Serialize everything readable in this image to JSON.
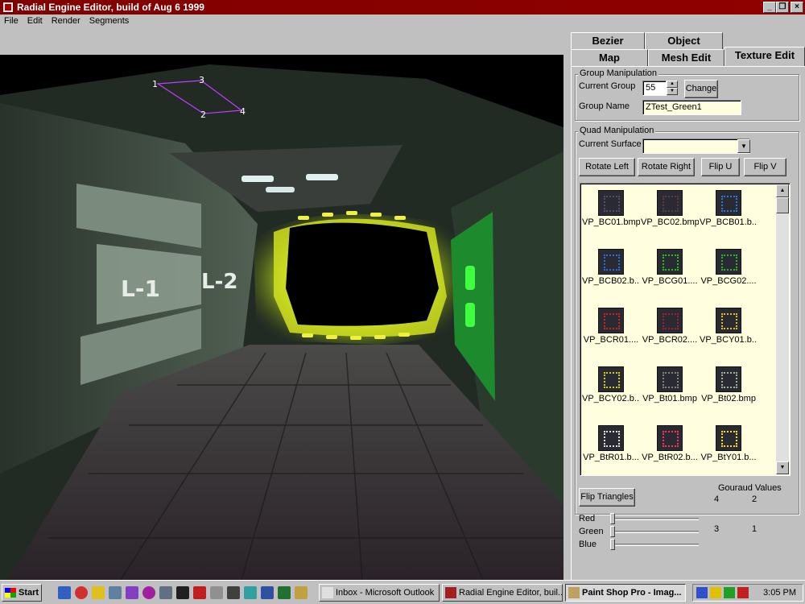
{
  "window": {
    "title": "Radial Engine Editor, build of Aug  6 1999",
    "minimize": "_",
    "maximize": "❐",
    "close": "×"
  },
  "menu": [
    "File",
    "Edit",
    "Render",
    "Segments"
  ],
  "viewport": {
    "markers": [
      "1",
      "3",
      "2",
      "4"
    ],
    "wall_signs": [
      "L-1",
      "L-2"
    ]
  },
  "tabs": {
    "row1": [
      "Bezier",
      "Object"
    ],
    "row2": [
      "Map",
      "Mesh Edit",
      "Texture Edit"
    ],
    "active": "Texture Edit"
  },
  "group_manipulation": {
    "legend": "Group Manipulation",
    "current_group_label": "Current Group",
    "current_group_value": "55",
    "change_button": "Change",
    "group_name_label": "Group Name",
    "group_name_value": "ZTest_Green1"
  },
  "quad_manipulation": {
    "legend": "Quad Manipulation",
    "current_surface_label": "Current Surface",
    "current_surface_value": "",
    "buttons": [
      "Rotate Left",
      "Rotate Right",
      "Flip U",
      "Flip V"
    ]
  },
  "textures": [
    {
      "name": "VP_BC01.bmp",
      "color": "#5a4a6a"
    },
    {
      "name": "VP_BC02.bmp",
      "color": "#5a3a4a"
    },
    {
      "name": "VP_BCB01.b...",
      "color": "#2a7ad8"
    },
    {
      "name": "VP_BCB02.b...",
      "color": "#2a6ae0"
    },
    {
      "name": "VP_BCG01....",
      "color": "#20c020"
    },
    {
      "name": "VP_BCG02....",
      "color": "#30b030"
    },
    {
      "name": "VP_BCR01....",
      "color": "#d02020"
    },
    {
      "name": "VP_BCR02....",
      "color": "#a02030"
    },
    {
      "name": "VP_BCY01.b...",
      "color": "#e0c020"
    },
    {
      "name": "VP_BCY02.b...",
      "color": "#d8c818"
    },
    {
      "name": "VP_Bt01.bmp",
      "color": "#808080"
    },
    {
      "name": "VP_Bt02.bmp",
      "color": "#a0b0a0"
    },
    {
      "name": "VP_BtR01.b...",
      "color": "#e0e0e0"
    },
    {
      "name": "VP_BtR02.b...",
      "color": "#ff3050"
    },
    {
      "name": "VP_BtY01.b...",
      "color": "#ffe020"
    }
  ],
  "triangles": {
    "flip_button": "Flip Triangles",
    "gouraud_label": "Gouraud Values",
    "values": [
      "4",
      "2",
      "3",
      "1"
    ],
    "sliders": [
      {
        "label": "Red",
        "value": 0
      },
      {
        "label": "Green",
        "value": 0
      },
      {
        "label": "Blue",
        "value": 0
      }
    ]
  },
  "taskbar": {
    "start": "Start",
    "tasks": [
      {
        "label": "Inbox - Microsoft Outlook",
        "active": false
      },
      {
        "label": "Radial Engine Editor, buil...",
        "active": false
      },
      {
        "label": "Paint Shop Pro - Imag...",
        "active": true
      }
    ],
    "clock": "3:05 PM"
  }
}
